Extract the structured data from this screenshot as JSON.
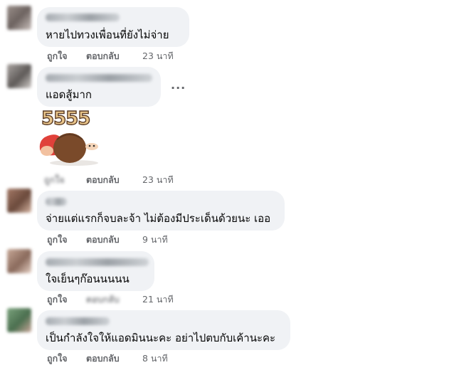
{
  "comments": [
    {
      "text": "หายไปทวงเพื่อนที่ยังไม่จ่าย",
      "like": "ถูกใจ",
      "reply": "ตอบกลับ",
      "time": "23 นาที"
    },
    {
      "text": "แอดสู้มาก",
      "more": "···",
      "sticker_text": "5555",
      "like": "ถูกใจ",
      "reply": "ตอบกลับ",
      "time": "23 นาที"
    },
    {
      "text": "จ่ายแต่แรกก็จบละจ้า ไม่ต้องมีประเด็นด้วยนะ เออ",
      "like": "ถูกใจ",
      "reply": "ตอบกลับ",
      "time": "9 นาที"
    },
    {
      "text": "ใจเย็นๆก๊อนนนนน",
      "like": "ถูกใจ",
      "reply": "ตอบกลับ",
      "time": "21 นาที"
    },
    {
      "text": "เป็นกำลังใจให้แอดมินนะคะ อย่าไปตบกับเค้านะคะ",
      "like": "ถูกใจ",
      "reply": "ตอบกลับ",
      "time": "8 นาที"
    }
  ]
}
